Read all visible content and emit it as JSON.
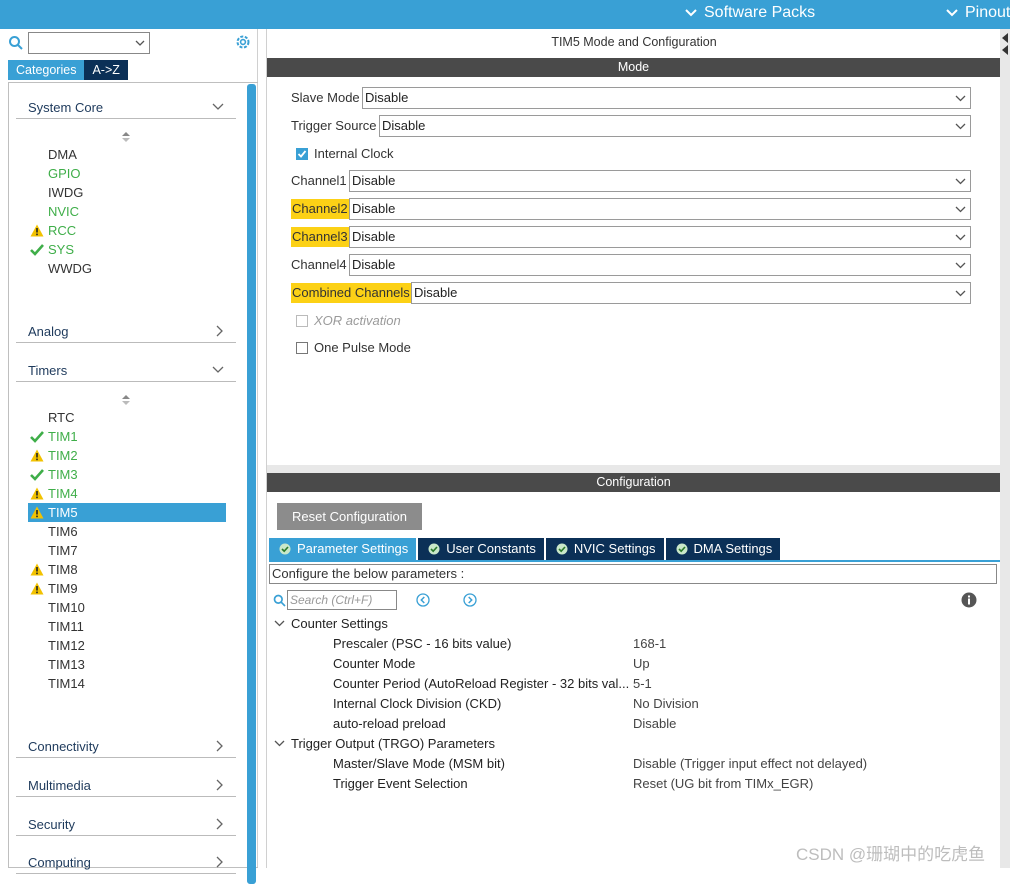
{
  "topbar": {
    "software_packs": "Software Packs",
    "pinout": "Pinout"
  },
  "left": {
    "tabs": [
      "Categories",
      "A->Z"
    ],
    "sections": {
      "system_core": "System Core",
      "analog": "Analog",
      "timers": "Timers",
      "connectivity": "Connectivity",
      "multimedia": "Multimedia",
      "security": "Security",
      "computing": "Computing"
    },
    "system_core_items": [
      "DMA",
      "GPIO",
      "IWDG",
      "NVIC",
      "RCC",
      "SYS",
      "WWDG"
    ],
    "timer_items": [
      "RTC",
      "TIM1",
      "TIM2",
      "TIM3",
      "TIM4",
      "TIM5",
      "TIM6",
      "TIM7",
      "TIM8",
      "TIM9",
      "TIM10",
      "TIM11",
      "TIM12",
      "TIM13",
      "TIM14"
    ]
  },
  "mode": {
    "title": "TIM5 Mode and Configuration",
    "header": "Mode",
    "slave_mode": {
      "label": "Slave Mode",
      "value": "Disable"
    },
    "trigger_source": {
      "label": "Trigger Source",
      "value": "Disable"
    },
    "internal_clock": "Internal Clock",
    "channel1": {
      "label": "Channel1",
      "value": "Disable"
    },
    "channel2": {
      "label": "Channel2",
      "value": "Disable"
    },
    "channel3": {
      "label": "Channel3",
      "value": "Disable"
    },
    "channel4": {
      "label": "Channel4",
      "value": "Disable"
    },
    "combined": {
      "label": "Combined Channels",
      "value": "Disable"
    },
    "xor": "XOR activation",
    "one_pulse": "One Pulse Mode"
  },
  "config": {
    "header": "Configuration",
    "reset": "Reset Configuration",
    "tabs": [
      "Parameter Settings",
      "User Constants",
      "NVIC Settings",
      "DMA Settings"
    ],
    "hint": "Configure the below parameters :",
    "search_placeholder": "Search (Ctrl+F)",
    "counter_settings": "Counter Settings",
    "params": [
      {
        "name": "Prescaler (PSC - 16 bits value)",
        "value": "168-1"
      },
      {
        "name": "Counter Mode",
        "value": "Up"
      },
      {
        "name": "Counter Period (AutoReload Register - 32 bits val...",
        "value": "5-1"
      },
      {
        "name": "Internal Clock Division (CKD)",
        "value": "No Division"
      },
      {
        "name": "auto-reload preload",
        "value": "Disable"
      }
    ],
    "trgo": "Trigger Output (TRGO) Parameters",
    "trgo_params": [
      {
        "name": "Master/Slave Mode (MSM bit)",
        "value": "Disable (Trigger input effect not delayed)"
      },
      {
        "name": "Trigger Event Selection",
        "value": "Reset (UG bit from TIMx_EGR)"
      }
    ]
  },
  "watermark": "CSDN @珊瑚中的吃虎鱼",
  "colors": {
    "accent": "#39a0d5",
    "navy": "#0b3057",
    "ok_green": "#3fae49",
    "warn_yellow": "#f2c200",
    "highlight": "#fcd116"
  }
}
